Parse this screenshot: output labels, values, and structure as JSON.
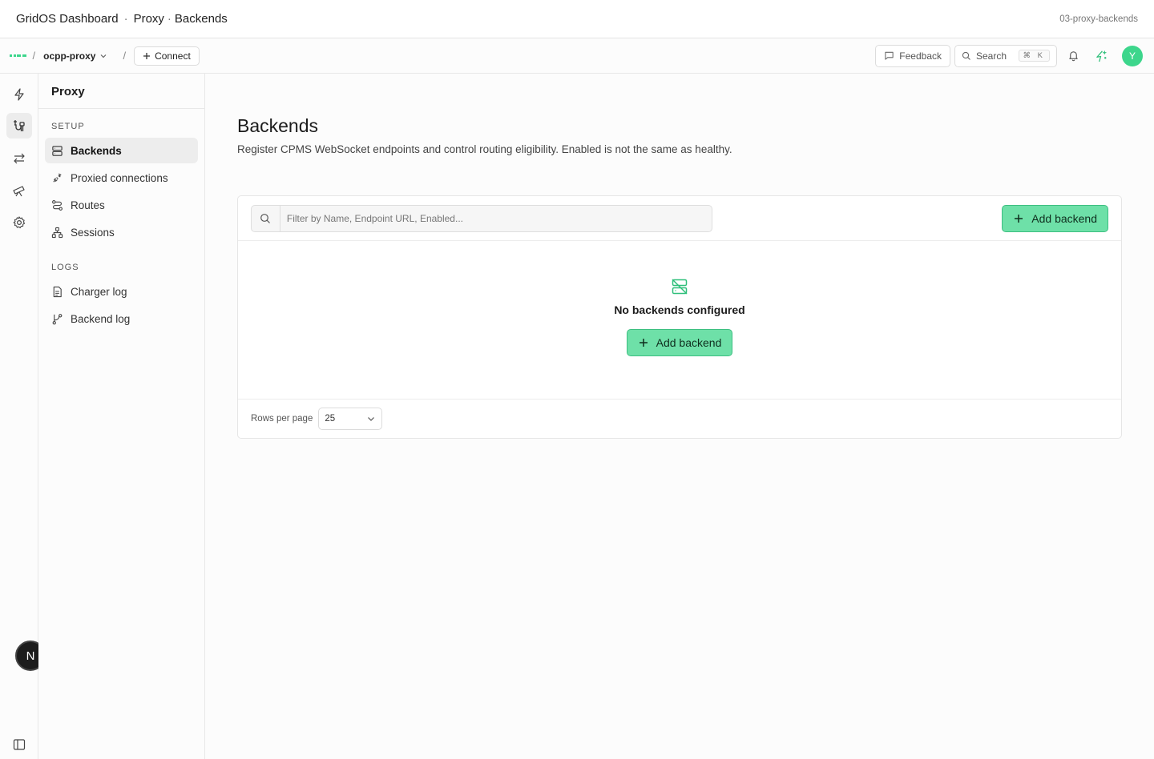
{
  "window": {
    "app_title": "GridOS Dashboard",
    "breadcrumb": [
      "Proxy",
      "Backends"
    ],
    "page_id": "03-proxy-backends"
  },
  "topnav": {
    "separator": "/",
    "project": "ocpp-proxy",
    "connect_label": "Connect",
    "feedback_label": "Feedback",
    "search_label": "Search",
    "search_shortcut": "⌘ K",
    "avatar_initial": "Y",
    "accent": "#3dd68c"
  },
  "rail": {
    "items": [
      "bolt-icon",
      "proxy-icon",
      "transfer-icon",
      "telescope-icon",
      "settings-icon"
    ],
    "active": "proxy-icon",
    "badge": "N"
  },
  "sidebar": {
    "title": "Proxy",
    "sections": [
      {
        "label": "SETUP",
        "items": [
          {
            "label": "Backends",
            "icon": "server-icon",
            "active": true
          },
          {
            "label": "Proxied connections",
            "icon": "plug-icon",
            "active": false
          },
          {
            "label": "Routes",
            "icon": "route-icon",
            "active": false
          },
          {
            "label": "Sessions",
            "icon": "network-icon",
            "active": false
          }
        ]
      },
      {
        "label": "LOGS",
        "items": [
          {
            "label": "Charger log",
            "icon": "file-icon",
            "active": false
          },
          {
            "label": "Backend log",
            "icon": "branch-icon",
            "active": false
          }
        ]
      }
    ]
  },
  "main": {
    "title": "Backends",
    "description": "Register CPMS WebSocket endpoints and control routing eligibility. Enabled is not the same as healthy.",
    "filter_placeholder": "Filter by Name, Endpoint URL, Enabled...",
    "add_button_label": "Add backend",
    "empty_title": "No backends configured",
    "empty_button_label": "Add backend",
    "rows_per_page_label": "Rows per page",
    "rows_per_page_value": "25"
  }
}
